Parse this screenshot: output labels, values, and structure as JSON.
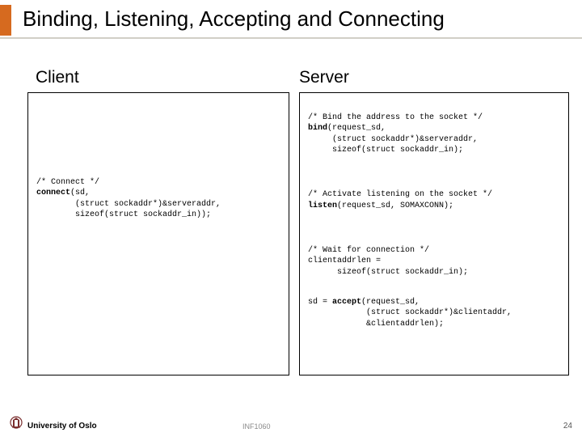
{
  "title": "Binding, Listening, Accepting and Connecting",
  "labels": {
    "client": "Client",
    "server": "Server"
  },
  "client": {
    "c1": "/* Connect */",
    "c2a": "connect",
    "c2b": "(sd,",
    "c3": "        (struct sockaddr*)&serveraddr,",
    "c4": "        sizeof(struct sockaddr_in));"
  },
  "server": {
    "b1": "/* Bind the address to the socket */",
    "b2a": "bind",
    "b2b": "(request_sd,",
    "b3": "     (struct sockaddr*)&serveraddr,",
    "b4": "     sizeof(struct sockaddr_in);",
    "l1": "/* Activate listening on the socket */",
    "l2a": "listen",
    "l2b": "(request_sd, SOMAXCONN);",
    "w1": "/* Wait for connection */",
    "w2": "clientaddrlen =",
    "w3": "      sizeof(struct sockaddr_in);",
    "a1a": "sd = ",
    "a1b": "accept",
    "a1c": "(request_sd,",
    "a2": "            (struct sockaddr*)&clientaddr,",
    "a3": "            &clientaddrlen);"
  },
  "footer": {
    "university": "University of Oslo",
    "course": "INF1060",
    "page": "24"
  }
}
